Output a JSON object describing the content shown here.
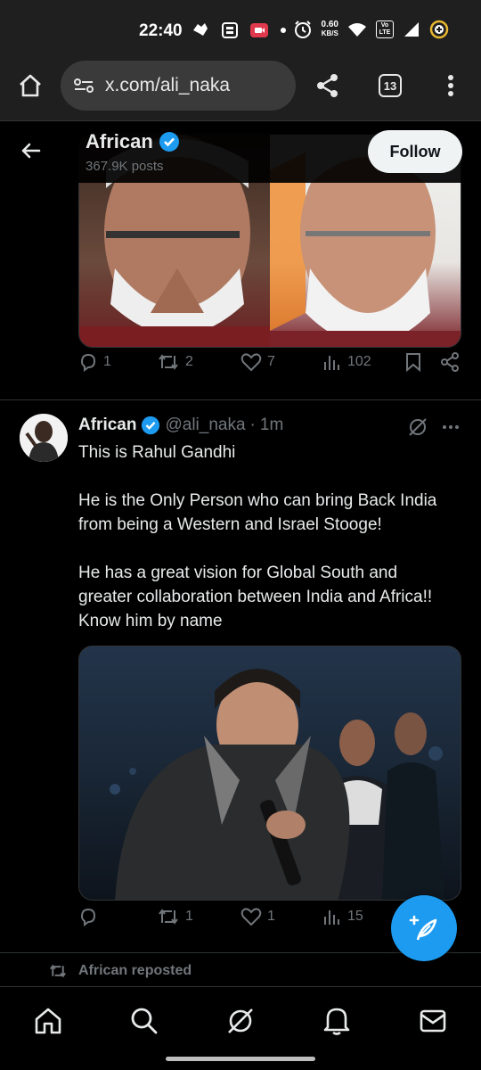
{
  "status_bar": {
    "time": "22:40",
    "net_speed_value": "0.60",
    "net_speed_unit": "KB/S",
    "volte_top": "Vo",
    "volte_bottom": "LTE"
  },
  "browser": {
    "url": "x.com/ali_naka",
    "tab_count": "13"
  },
  "profile_header": {
    "name": "African",
    "posts": "367.9K posts",
    "follow_label": "Follow"
  },
  "tweet1": {
    "replies": "1",
    "reposts": "2",
    "likes": "7",
    "views": "102"
  },
  "tweet2": {
    "name": "African",
    "handle": "@ali_naka",
    "separator": "·",
    "time": "1m",
    "text_lines": [
      "This is Rahul Gandhi",
      "",
      "He is the Only Person who can bring Back India",
      "from being a Western and Israel Stooge!",
      "",
      "He has a great vision for Global South and",
      "greater collaboration between India and Africa!!",
      "Know him by name"
    ],
    "reposts": "1",
    "likes": "1",
    "views": "15"
  },
  "repost_banner": "African reposted",
  "colors": {
    "accent": "#1d9bf0",
    "background": "#000000",
    "muted": "#71767b",
    "text": "#e7e9ea"
  }
}
